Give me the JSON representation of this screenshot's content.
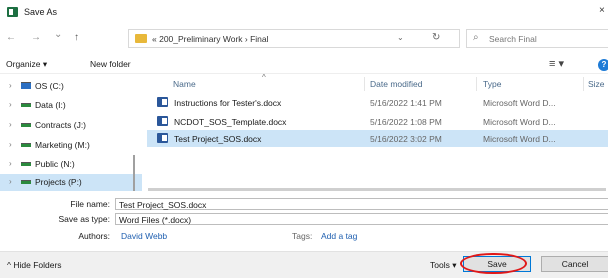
{
  "window": {
    "title": "Save As",
    "close_label": "×"
  },
  "address": {
    "back": "←",
    "forward": "→",
    "history": "⌄",
    "up": "↑",
    "crumbs": "« 200_Preliminary Work  ›  Final",
    "dropdown": "⌄",
    "refresh": "↻",
    "search_placeholder": "Search Final"
  },
  "toolbar": {
    "organize": "Organize ▾",
    "new_folder": "New folder",
    "view": "≡ ▾",
    "help": "?"
  },
  "sidebar": {
    "items": [
      {
        "label": "OS (C:)"
      },
      {
        "label": "Data (I:)"
      },
      {
        "label": "Contracts (J:)"
      },
      {
        "label": "Marketing (M:)"
      },
      {
        "label": "Public (N:)"
      },
      {
        "label": "Projects (P:)"
      }
    ]
  },
  "columns": {
    "name": "Name",
    "date": "Date modified",
    "type": "Type",
    "size": "Size"
  },
  "files": [
    {
      "name": "Instructions for Tester's.docx",
      "date": "5/16/2022 1:41 PM",
      "type": "Microsoft Word D..."
    },
    {
      "name": "NCDOT_SOS_Template.docx",
      "date": "5/16/2022 1:08 PM",
      "type": "Microsoft Word D..."
    },
    {
      "name": "Test Project_SOS.docx",
      "date": "5/16/2022 3:02 PM",
      "type": "Microsoft Word D..."
    }
  ],
  "form": {
    "file_name_label": "File name:",
    "file_name_value": "Test Project_SOS.docx",
    "save_type_label": "Save as type:",
    "save_type_value": "Word Files (*.docx)",
    "authors_label": "Authors:",
    "authors_value": "David Webb",
    "tags_label": "Tags:",
    "tags_value": "Add a tag"
  },
  "footer": {
    "hide_folders": "Hide Folders",
    "tools": "Tools  ▾",
    "save": "Save",
    "cancel": "Cancel"
  },
  "colors": {
    "selection": "#cce4f7",
    "link": "#2060b0",
    "accent": "#0078d7",
    "annotation": "#e01818"
  }
}
